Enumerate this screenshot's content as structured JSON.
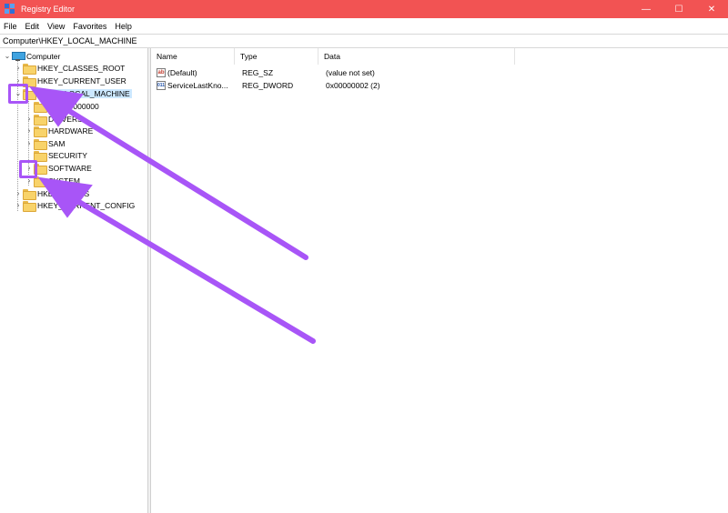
{
  "window": {
    "title": "Registry Editor",
    "controls": {
      "minimize": "—",
      "maximize": "☐",
      "close": "✕"
    }
  },
  "menu": [
    "File",
    "Edit",
    "View",
    "Favorites",
    "Help"
  ],
  "address": "Computer\\HKEY_LOCAL_MACHINE",
  "tree": {
    "root": "Computer",
    "hives": [
      {
        "label": "HKEY_CLASSES_ROOT"
      },
      {
        "label": "HKEY_CURRENT_USER"
      },
      {
        "label": "HKEY_LOCAL_MACHINE"
      },
      {
        "label": "HKEY_USERS"
      },
      {
        "label": "HKEY_CURRENT_CONFIG"
      }
    ],
    "hklm_children": [
      "BCD00000000",
      "DRIVERS",
      "HARDWARE",
      "SAM",
      "SECURITY",
      "SOFTWARE",
      "SYSTEM"
    ]
  },
  "list": {
    "columns": [
      "Name",
      "Type",
      "Data"
    ],
    "rows": [
      {
        "name": "(Default)",
        "type": "REG_SZ",
        "data": "(value not set)",
        "icon": "string-value-icon"
      },
      {
        "name": "ServiceLastKno...",
        "type": "REG_DWORD",
        "data": "0x00000002 (2)",
        "icon": "binary-value-icon"
      }
    ]
  },
  "annotation_color": "#a855f7",
  "titlebar_color": "#f25353"
}
